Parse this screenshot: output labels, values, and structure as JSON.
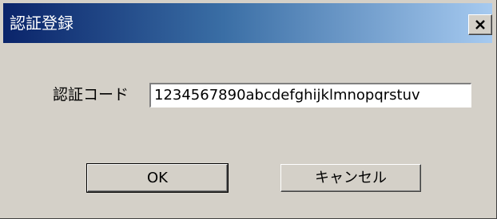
{
  "dialog": {
    "title": "認証登録",
    "close_icon": "close-icon"
  },
  "form": {
    "code_label": "認証コード",
    "code_value": "1234567890abcdefghijklmnopqrstuv"
  },
  "buttons": {
    "ok_label": "OK",
    "cancel_label": "キャンセル"
  },
  "colors": {
    "title_gradient_start": "#0a246a",
    "title_gradient_end": "#a6caf0",
    "dialog_background": "#d4d0c8"
  }
}
